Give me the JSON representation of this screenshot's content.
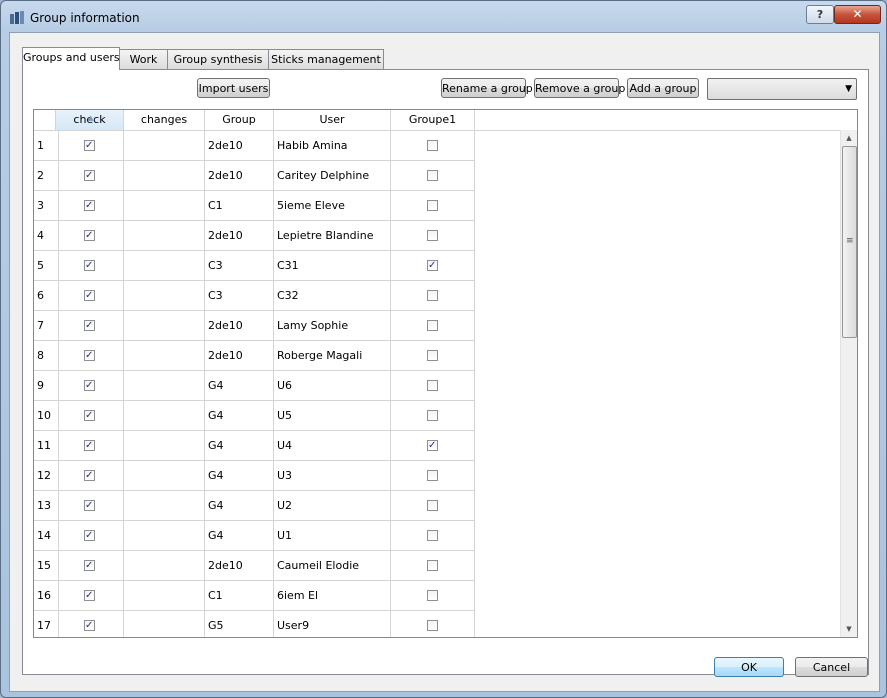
{
  "window": {
    "title": "Group information",
    "help_label": "?",
    "close_label": "✕"
  },
  "tabs": [
    {
      "label": "Groups and users",
      "active": true
    },
    {
      "label": "Work",
      "active": false
    },
    {
      "label": "Group synthesis",
      "active": false
    },
    {
      "label": "Sticks management",
      "active": false
    }
  ],
  "toolbar": {
    "import_users": "Import users",
    "rename_group": "Rename a group",
    "remove_group": "Remove a group",
    "add_group": "Add a group",
    "group_select_value": ""
  },
  "table": {
    "columns": [
      "check",
      "changes",
      "Group",
      "User",
      "Groupe1"
    ],
    "rows": [
      {
        "n": "1",
        "check": true,
        "changes": "",
        "group": "2de10",
        "user": "Habib Amina",
        "groupe1": false
      },
      {
        "n": "2",
        "check": true,
        "changes": "",
        "group": "2de10",
        "user": "Caritey Delphine",
        "groupe1": false
      },
      {
        "n": "3",
        "check": true,
        "changes": "",
        "group": "C1",
        "user": "5ieme Eleve",
        "groupe1": false
      },
      {
        "n": "4",
        "check": true,
        "changes": "",
        "group": "2de10",
        "user": "Lepietre Blandine",
        "groupe1": false
      },
      {
        "n": "5",
        "check": true,
        "changes": "",
        "group": "C3",
        "user": "C31",
        "groupe1": true
      },
      {
        "n": "6",
        "check": true,
        "changes": "",
        "group": "C3",
        "user": "C32",
        "groupe1": false
      },
      {
        "n": "7",
        "check": true,
        "changes": "",
        "group": "2de10",
        "user": "Lamy Sophie",
        "groupe1": false
      },
      {
        "n": "8",
        "check": true,
        "changes": "",
        "group": "2de10",
        "user": "Roberge Magali",
        "groupe1": false
      },
      {
        "n": "9",
        "check": true,
        "changes": "",
        "group": "G4",
        "user": "U6",
        "groupe1": false
      },
      {
        "n": "10",
        "check": true,
        "changes": "",
        "group": "G4",
        "user": "U5",
        "groupe1": false
      },
      {
        "n": "11",
        "check": true,
        "changes": "",
        "group": "G4",
        "user": "U4",
        "groupe1": true
      },
      {
        "n": "12",
        "check": true,
        "changes": "",
        "group": "G4",
        "user": "U3",
        "groupe1": false
      },
      {
        "n": "13",
        "check": true,
        "changes": "",
        "group": "G4",
        "user": "U2",
        "groupe1": false
      },
      {
        "n": "14",
        "check": true,
        "changes": "",
        "group": "G4",
        "user": "U1",
        "groupe1": false
      },
      {
        "n": "15",
        "check": true,
        "changes": "",
        "group": "2de10",
        "user": "Caumeil Elodie",
        "groupe1": false
      },
      {
        "n": "16",
        "check": true,
        "changes": "",
        "group": "C1",
        "user": "6iem El",
        "groupe1": false
      },
      {
        "n": "17",
        "check": true,
        "changes": "",
        "group": "G5",
        "user": "User9",
        "groupe1": false
      }
    ]
  },
  "footer": {
    "ok_label": "OK",
    "cancel_label": "Cancel"
  },
  "colors": {
    "title_bar": "#b7cde5",
    "close_button": "#c6543b",
    "checkbox_tick": "#27347c"
  },
  "icons": {
    "app": "app-icon",
    "help": "help-icon",
    "close": "close-icon",
    "dropdown": "chevron-down-icon"
  }
}
